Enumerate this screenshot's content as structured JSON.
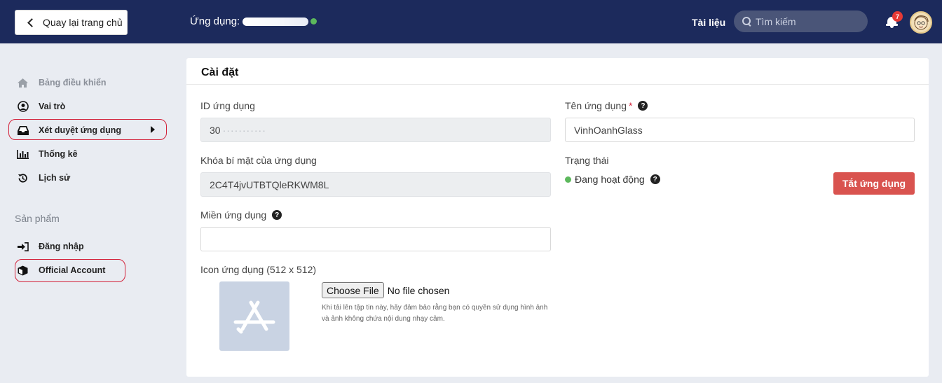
{
  "header": {
    "back_label": "Quay lại trang chủ",
    "app_label": "Ứng dụng:",
    "docs_label": "Tài liệu",
    "search_placeholder": "Tìm kiếm",
    "notification_count": "7",
    "status_color": "#5cb85c"
  },
  "sidebar": {
    "items": [
      {
        "label": "Bảng điều khiển",
        "icon": "home-icon"
      },
      {
        "label": "Vai trò",
        "icon": "user-circle-icon"
      },
      {
        "label": "Xét duyệt ứng dụng",
        "icon": "inbox-icon"
      },
      {
        "label": "Thống kê",
        "icon": "bar-chart-icon"
      },
      {
        "label": "Lịch sử",
        "icon": "history-icon"
      }
    ],
    "section_title": "Sản phẩm",
    "product_items": [
      {
        "label": "Đăng nhập",
        "icon": "sign-in-icon"
      },
      {
        "label": "Official Account",
        "icon": "box-icon"
      }
    ]
  },
  "settings": {
    "title": "Cài đặt",
    "app_id_label": "ID ứng dụng",
    "app_id_value": "30",
    "secret_label": "Khóa bí mật của ứng dụng",
    "secret_value": "2C4T4jvUTBTQleRKWM8L",
    "domain_label": "Miền ứng dụng",
    "domain_value": "",
    "app_name_label": "Tên ứng dụng",
    "app_name_required": "*",
    "app_name_value": "VinhOanhGlass",
    "status_label": "Trạng thái",
    "status_value": "Đang hoạt động",
    "disable_button": "Tắt ứng dụng",
    "icon_label": "Icon ứng dụng (512 x 512)",
    "choose_file": "Choose File",
    "no_file": "No file chosen",
    "file_note": "Khi tải lên tập tin này, hãy đảm bảo rằng bạn có quyền sử dụng hình ảnh và ảnh không chứa nội dung nhạy cảm.",
    "accent_red": "#d9534f",
    "header_color": "#1c2a5c"
  }
}
